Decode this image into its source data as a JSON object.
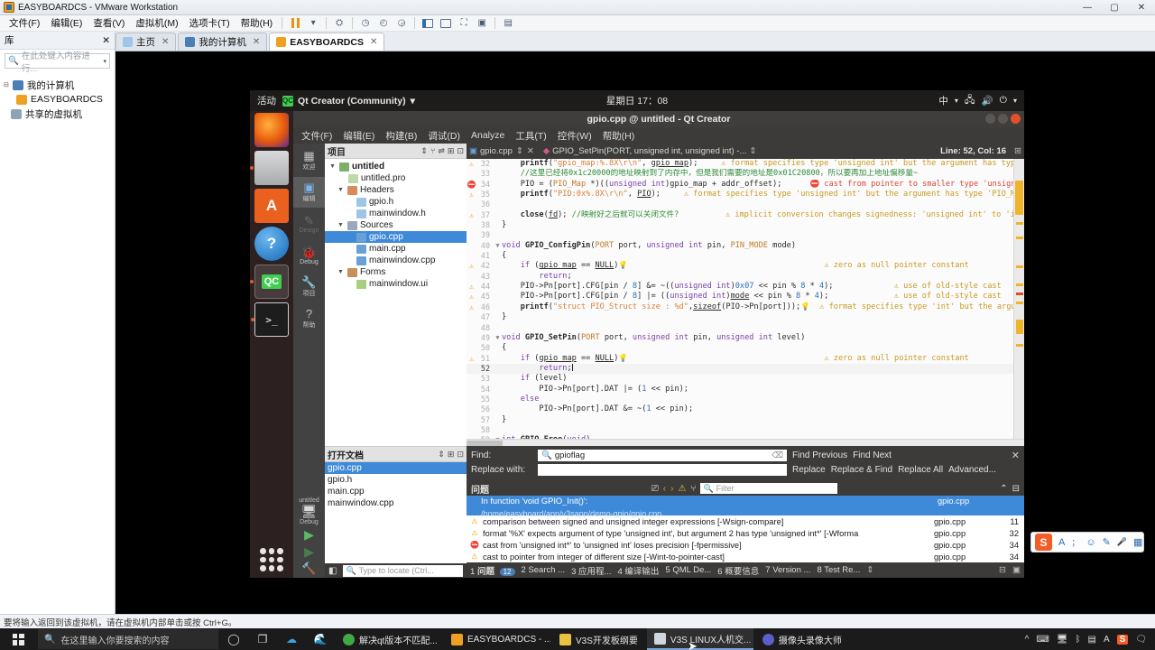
{
  "vmware": {
    "window_title": "EASYBOARDCS - VMware Workstation",
    "menus": [
      "文件(F)",
      "编辑(E)",
      "查看(V)",
      "虚拟机(M)",
      "选项卡(T)",
      "帮助(H)"
    ],
    "window_buttons": {
      "minimize": "—",
      "maximize": "▢",
      "close": "✕"
    },
    "library": {
      "header_title": "库",
      "header_close": "✕",
      "search_placeholder": "在此处键入内容进行...",
      "tree": [
        {
          "label": "我的计算机",
          "icon": "computer-icon"
        },
        {
          "label": "EASYBOARDCS",
          "icon": "vm-icon"
        },
        {
          "label": "共享的虚拟机",
          "icon": "shared-vm-icon"
        }
      ]
    },
    "tabs": [
      {
        "label": "主页",
        "icon": "home-icon",
        "active": false
      },
      {
        "label": "我的计算机",
        "icon": "computer-icon",
        "active": false
      },
      {
        "label": "EASYBOARDCS",
        "icon": "vm-icon",
        "active": true
      }
    ],
    "statusbar": "要将输入返回到该虚拟机，请在虚拟机内部单击或按 Ctrl+G。"
  },
  "ubuntu": {
    "activities": "活动",
    "app_name": "Qt Creator (Community)",
    "app_menu_caret": "▾",
    "clock": "星期日 17：08",
    "indicators": {
      "input_method": "中",
      "network": "network-icon",
      "volume": "volume-icon",
      "power": "power-icon",
      "caret": "▾"
    },
    "dock": [
      {
        "name": "firefox",
        "glyph": "🦊",
        "running": false
      },
      {
        "name": "files",
        "glyph": "🗄",
        "running": true
      },
      {
        "name": "software",
        "glyph": "A",
        "running": false
      },
      {
        "name": "help",
        "glyph": "?",
        "running": false
      },
      {
        "name": "qtcreator",
        "glyph": "QC",
        "running": true,
        "active": true
      },
      {
        "name": "terminal",
        "glyph": ">_",
        "running": true
      },
      {
        "name": "show-applications",
        "glyph": "grid",
        "running": false
      }
    ]
  },
  "qtcreator": {
    "window_title": "gpio.cpp @ untitled - Qt Creator",
    "menus": [
      "文件(F)",
      "编辑(E)",
      "构建(B)",
      "调试(D)",
      "Analyze",
      "工具(T)",
      "控件(W)",
      "帮助(H)"
    ],
    "modes": [
      {
        "label": "欢迎",
        "icon": "welcome-icon"
      },
      {
        "label": "编辑",
        "icon": "edit-icon",
        "active": true
      },
      {
        "label": "Design",
        "icon": "design-icon",
        "disabled": true
      },
      {
        "label": "Debug",
        "icon": "debug-icon"
      },
      {
        "label": "项目",
        "icon": "projects-icon"
      },
      {
        "label": "帮助",
        "icon": "help-icon"
      }
    ],
    "kit": {
      "project": "untitled",
      "config": "Debug",
      "run": "▶",
      "debug": "▶",
      "build": "🔨"
    },
    "project_panel": {
      "title": "项目",
      "tools": [
        "filter-icon",
        "sync-icon",
        "collapse-all-icon",
        "split-icon"
      ],
      "tree": [
        {
          "label": "untitled",
          "depth": 0,
          "expanded": true,
          "bold": true,
          "icon": "project-icon"
        },
        {
          "label": "untitled.pro",
          "depth": 1,
          "icon": "pro-file-icon"
        },
        {
          "label": "Headers",
          "depth": 1,
          "expanded": true,
          "icon": "folder-headers-icon"
        },
        {
          "label": "gpio.h",
          "depth": 2,
          "icon": "h-file-icon"
        },
        {
          "label": "mainwindow.h",
          "depth": 2,
          "icon": "h-file-icon"
        },
        {
          "label": "Sources",
          "depth": 1,
          "expanded": true,
          "icon": "folder-sources-icon"
        },
        {
          "label": "gpio.cpp",
          "depth": 2,
          "icon": "cpp-file-icon",
          "selected": true
        },
        {
          "label": "main.cpp",
          "depth": 2,
          "icon": "cpp-file-icon"
        },
        {
          "label": "mainwindow.cpp",
          "depth": 2,
          "icon": "cpp-file-icon"
        },
        {
          "label": "Forms",
          "depth": 1,
          "expanded": true,
          "icon": "folder-forms-icon"
        },
        {
          "label": "mainwindow.ui",
          "depth": 2,
          "icon": "ui-file-icon"
        }
      ]
    },
    "open_documents": {
      "title": "打开文档",
      "items": [
        {
          "label": "gpio.cpp",
          "selected": true
        },
        {
          "label": "gpio.h",
          "selected": false
        },
        {
          "label": "main.cpp",
          "selected": false
        },
        {
          "label": "mainwindow.cpp",
          "selected": false
        }
      ]
    },
    "editor": {
      "tab_label": "gpio.cpp",
      "symbol": "GPIO_SetPin(PORT, unsigned int, unsigned int) -...",
      "line_col": "Line: 52, Col: 16",
      "lines": [
        {
          "n": 32,
          "mark": "warn",
          "fold": "",
          "text": "    printf(\"gpio_map:%.8X\\r\\n\", gpio_map);",
          "annot": "format specifies type 'unsigned int' but the argument has type 'un…",
          "annot_type": "warn"
        },
        {
          "n": 33,
          "mark": "",
          "fold": "",
          "text": "    //这里已经将0x1c20000的地址映射到了内存中，但是我们需要的地址是0x01C20800，所以要再加上地址偏移量~",
          "comment": true
        },
        {
          "n": 34,
          "mark": "err",
          "fold": "",
          "text": "    PIO = (PIO_Map *)((unsigned int)gpio_map + addr_offset);",
          "annot": "cast from pointer to smaller type 'unsigned int'…",
          "annot_type": "err"
        },
        {
          "n": 35,
          "mark": "warn",
          "fold": "",
          "text": "    printf(\"PID:0x%.8X\\r\\n\", PIO);",
          "annot": "format specifies type 'unsigned int' but the argument has type 'PIO_Map *'",
          "annot_type": "warn"
        },
        {
          "n": 36,
          "mark": "",
          "fold": "",
          "text": ""
        },
        {
          "n": 37,
          "mark": "warn2",
          "fold": "",
          "text": "    close(fd); //映射好之后就可以关闭文件?",
          "annot": "implicit conversion changes signedness: 'unsigned int' to 'int'",
          "annot_type": "warn"
        },
        {
          "n": 38,
          "mark": "",
          "fold": "",
          "text": "}"
        },
        {
          "n": 39,
          "mark": "",
          "fold": "",
          "text": ""
        },
        {
          "n": 40,
          "mark": "",
          "fold": "▾",
          "text": "void GPIO_ConfigPin(PORT port, unsigned int pin, PIN_MODE mode)"
        },
        {
          "n": 41,
          "mark": "",
          "fold": "",
          "text": "{"
        },
        {
          "n": 42,
          "mark": "warn",
          "fold": "",
          "text": "    if (gpio_map == NULL)",
          "annot": "zero as null pointer constant",
          "annot_type": "warn",
          "bulb": true
        },
        {
          "n": 43,
          "mark": "",
          "fold": "",
          "text": "        return;"
        },
        {
          "n": 44,
          "mark": "warn",
          "fold": "",
          "text": "    PIO->Pn[port].CFG[pin / 8] &= ~((unsigned int)0x07 << pin % 8 * 4);",
          "annot": "use of old-style cast",
          "annot_type": "warn"
        },
        {
          "n": 45,
          "mark": "warn",
          "fold": "",
          "text": "    PIO->Pn[port].CFG[pin / 8] |= ((unsigned int)mode << pin % 8 * 4);",
          "annot": "use of old-style cast",
          "annot_type": "warn"
        },
        {
          "n": 46,
          "mark": "warn",
          "fold": "",
          "text": "    printf(\"struct PIO_Struct size : %d\",sizeof(PIO->Pn[port]));",
          "annot": "format specifies type 'int' but the argument…",
          "annot_type": "warn",
          "bulb": true
        },
        {
          "n": 47,
          "mark": "",
          "fold": "",
          "text": "}"
        },
        {
          "n": 48,
          "mark": "",
          "fold": "",
          "text": ""
        },
        {
          "n": 49,
          "mark": "",
          "fold": "▾",
          "text": "void GPIO_SetPin(PORT port, unsigned int pin, unsigned int level)"
        },
        {
          "n": 50,
          "mark": "",
          "fold": "",
          "text": "{"
        },
        {
          "n": 51,
          "mark": "warn",
          "fold": "",
          "text": "    if (gpio_map == NULL)",
          "annot": "zero as null pointer constant",
          "annot_type": "warn",
          "bulb": true
        },
        {
          "n": 52,
          "mark": "",
          "fold": "",
          "text": "        return;",
          "current": true,
          "caret": true
        },
        {
          "n": 53,
          "mark": "",
          "fold": "",
          "text": "    if (level)"
        },
        {
          "n": 54,
          "mark": "",
          "fold": "",
          "text": "        PIO->Pn[port].DAT |= (1 << pin);"
        },
        {
          "n": 55,
          "mark": "",
          "fold": "",
          "text": "    else"
        },
        {
          "n": 56,
          "mark": "",
          "fold": "",
          "text": "        PIO->Pn[port].DAT &= ~(1 << pin);"
        },
        {
          "n": 57,
          "mark": "",
          "fold": "",
          "text": "}"
        },
        {
          "n": 58,
          "mark": "",
          "fold": "",
          "text": ""
        },
        {
          "n": 59,
          "mark": "",
          "fold": "▾",
          "text": "int GPIO_Free(void)"
        }
      ]
    },
    "find_bar": {
      "find_label": "Find:",
      "find_value": "gpioflag",
      "replace_label": "Replace with:",
      "replace_value": "",
      "buttons_row1": [
        "Find Previous",
        "Find Next"
      ],
      "buttons_row2": [
        "Replace",
        "Replace & Find",
        "Replace All",
        "Advanced..."
      ],
      "close": "✕"
    },
    "issues_pane": {
      "title": "问题",
      "filter_placeholder": "Filter",
      "toolbar_icons": [
        "clear-icon",
        "prev-issue-icon",
        "next-issue-icon",
        "warning-filter-icon",
        "filter-icon"
      ],
      "header": {
        "text": "In function 'void GPIO_Init()':",
        "subtext": "/home/easyboard/app/v3sapp/demo-gpio/gpio.cpp",
        "file": "gpio.cpp"
      },
      "rows": [
        {
          "level": "warning",
          "message": "comparison between signed and unsigned integer expressions [-Wsign-compare]",
          "file": "gpio.cpp",
          "line": "11"
        },
        {
          "level": "warning",
          "message": "format '%X' expects argument of type 'unsigned int', but argument 2 has type 'unsigned int*' [-Wforma",
          "file": "gpio.cpp",
          "line": "32"
        },
        {
          "level": "error",
          "message": "cast from 'unsigned int*' to 'unsigned int' loses precision [-fpermissive]",
          "file": "gpio.cpp",
          "line": "34"
        },
        {
          "level": "warning",
          "message": "cast to pointer from integer of different size [-Wint-to-pointer-cast]",
          "file": "gpio.cpp",
          "line": "34"
        }
      ]
    },
    "output_tabs": [
      {
        "num": "1",
        "label": "问题",
        "badge": "12",
        "active": true
      },
      {
        "num": "2",
        "label": "Search ...",
        "badge": ""
      },
      {
        "num": "3",
        "label": "应用程...",
        "badge": ""
      },
      {
        "num": "4",
        "label": "编译输出",
        "badge": ""
      },
      {
        "num": "5",
        "label": "QML De...",
        "badge": ""
      },
      {
        "num": "6",
        "label": "概要信息",
        "badge": ""
      },
      {
        "num": "7",
        "label": "Version ...",
        "badge": ""
      },
      {
        "num": "8",
        "label": "Test Re...",
        "badge": ""
      }
    ],
    "locator_placeholder": "Type to locate (Ctrl..."
  },
  "windows_taskbar": {
    "search_placeholder": "在这里输入你要搜索的内容",
    "system_icons": [
      "cortana-icon",
      "task-view-icon",
      "cloud-icon",
      "edge-blue-icon"
    ],
    "tasks": [
      {
        "label": "解决qt版本不匹配...",
        "icon_color": "#3fa845",
        "active": false
      },
      {
        "label": "EASYBOARDCS - ...",
        "icon_color": "#f0a020",
        "active": false
      },
      {
        "label": "V3S开发板纲要",
        "icon_color": "#e8c341",
        "active": false
      },
      {
        "label": "V3S LINUX人机交...",
        "icon_color": "#cfd6de",
        "active": true
      },
      {
        "label": "摄像头录像大师",
        "icon_color": "#5b5fc7",
        "active": false
      }
    ],
    "tray": [
      "^",
      "keyboard-icon",
      "monitor-icon",
      "bluetooth-icon",
      "ime-icon",
      "A",
      "sogou-icon",
      "notification-icon"
    ]
  },
  "ime_toolbar": {
    "logo": "S",
    "buttons": [
      "A",
      "；",
      "☺",
      "✎",
      "🎤",
      "▦"
    ]
  }
}
